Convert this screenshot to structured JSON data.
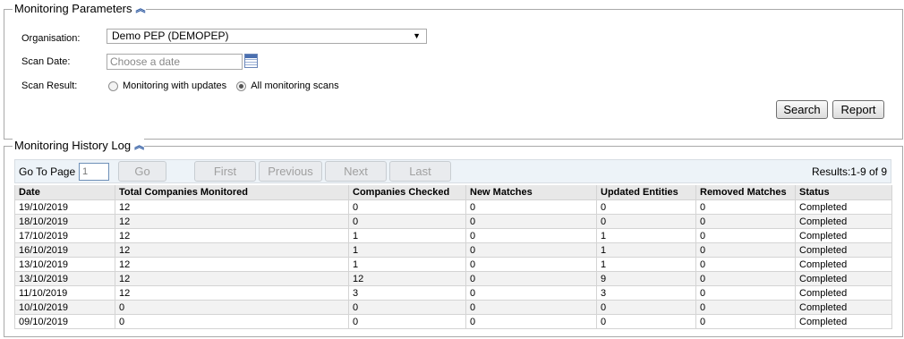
{
  "monitoring_parameters": {
    "title": "Monitoring Parameters",
    "collapse_icon": "double-chevron-up-icon",
    "organisation_label": "Organisation:",
    "organisation_value": "Demo PEP (DEMOPEP)",
    "scan_date_label": "Scan Date:",
    "scan_date_placeholder": "Choose a date",
    "scan_result_label": "Scan Result:",
    "scan_result_options": [
      {
        "label": "Monitoring with updates",
        "checked": false
      },
      {
        "label": "All monitoring scans",
        "checked": true
      }
    ],
    "search_label": "Search",
    "report_label": "Report"
  },
  "history_log": {
    "title": "Monitoring History Log",
    "collapse_icon": "double-chevron-up-icon",
    "pager": {
      "goto_label": "Go To Page",
      "page_value": "1",
      "go_label": "Go",
      "first_label": "First",
      "previous_label": "Previous",
      "next_label": "Next",
      "last_label": "Last",
      "results": "Results:1-9 of 9"
    },
    "columns": [
      "Date",
      "Total Companies Monitored",
      "Companies Checked",
      "New Matches",
      "Updated Entities",
      "Removed Matches",
      "Status"
    ],
    "rows": [
      [
        "19/10/2019",
        "12",
        "0",
        "0",
        "0",
        "0",
        "Completed"
      ],
      [
        "18/10/2019",
        "12",
        "0",
        "0",
        "0",
        "0",
        "Completed"
      ],
      [
        "17/10/2019",
        "12",
        "1",
        "0",
        "1",
        "0",
        "Completed"
      ],
      [
        "16/10/2019",
        "12",
        "1",
        "0",
        "1",
        "0",
        "Completed"
      ],
      [
        "13/10/2019",
        "12",
        "1",
        "0",
        "1",
        "0",
        "Completed"
      ],
      [
        "13/10/2019",
        "12",
        "12",
        "0",
        "9",
        "0",
        "Completed"
      ],
      [
        "11/10/2019",
        "12",
        "3",
        "0",
        "3",
        "0",
        "Completed"
      ],
      [
        "10/10/2019",
        "0",
        "0",
        "0",
        "0",
        "0",
        "Completed"
      ],
      [
        "09/10/2019",
        "0",
        "0",
        "0",
        "0",
        "0",
        "Completed"
      ]
    ]
  }
}
